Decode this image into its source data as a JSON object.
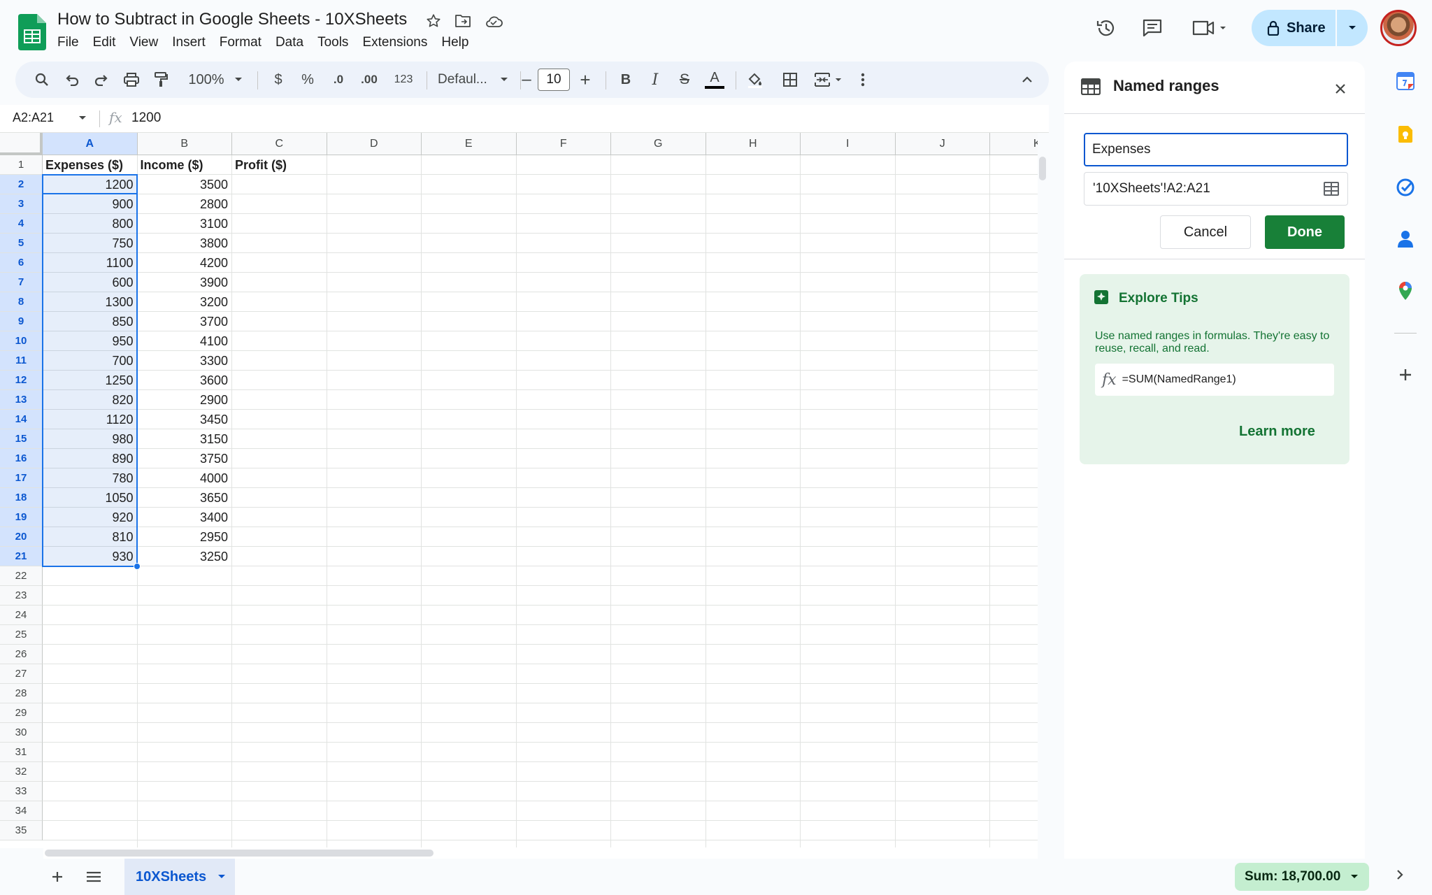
{
  "app": {
    "doc_title": "How to Subtract in Google Sheets - 10XSheets",
    "menu": [
      "File",
      "Edit",
      "View",
      "Insert",
      "Format",
      "Data",
      "Tools",
      "Extensions",
      "Help"
    ],
    "share_label": "Share",
    "brand_color": "#0f9d58",
    "accent_color": "#0b57d0"
  },
  "toolbar": {
    "zoom": "100%",
    "currency": "$",
    "percent": "%",
    "decrease_decimal": ".0",
    "increase_decimal": ".00",
    "number_format": "123",
    "font": "Defaul...",
    "minus": "–",
    "font_size": "10",
    "plus": "+",
    "bold": "B",
    "italic": "I",
    "strike": "S",
    "text_color": "A"
  },
  "formula_bar": {
    "name_box": "A2:A21",
    "fx": "fx",
    "value": "1200"
  },
  "grid": {
    "columns": [
      "A",
      "B",
      "C",
      "D",
      "E",
      "F",
      "G",
      "H",
      "I",
      "J",
      "K"
    ],
    "row_numbers": [
      "1",
      "2",
      "3",
      "4",
      "5",
      "6",
      "7",
      "8",
      "9",
      "10",
      "11",
      "12",
      "13",
      "14",
      "15",
      "16",
      "17",
      "18",
      "19",
      "20",
      "21",
      "22",
      "23",
      "24",
      "25",
      "26",
      "27",
      "28",
      "29",
      "30",
      "31",
      "32",
      "33",
      "34",
      "35"
    ],
    "headers": [
      "Expenses ($)",
      "Income ($)",
      "Profit ($)"
    ],
    "expenses": [
      "1200",
      "900",
      "800",
      "750",
      "1100",
      "600",
      "1300",
      "850",
      "950",
      "700",
      "1250",
      "820",
      "1120",
      "980",
      "890",
      "780",
      "1050",
      "920",
      "810",
      "930"
    ],
    "income": [
      "3500",
      "2800",
      "3100",
      "3800",
      "4200",
      "3900",
      "3200",
      "3700",
      "4100",
      "3300",
      "3600",
      "2900",
      "3450",
      "3150",
      "3750",
      "4000",
      "3650",
      "3400",
      "2950",
      "3250"
    ]
  },
  "sheet_tabs": {
    "active": "10XSheets",
    "sum": "Sum: 18,700.00"
  },
  "named_ranges_panel": {
    "title": "Named ranges",
    "name_value": "Expenses",
    "range_value": "'10XSheets'!A2:A21",
    "cancel_label": "Cancel",
    "done_label": "Done",
    "tips_title": "Explore Tips",
    "tips_body": "Use named ranges in formulas. They're easy to reuse, recall, and read.",
    "tips_fx": "fx",
    "tips_formula": "=SUM(NamedRange1)",
    "learn_more": "Learn more"
  },
  "icons": [
    "sheets-logo-icon",
    "star-icon",
    "move-folder-icon",
    "cloud-saved-icon",
    "history-icon",
    "comment-icon",
    "meet-icon",
    "lock-icon",
    "search-icon",
    "undo-icon",
    "redo-icon",
    "print-icon",
    "paint-format-icon",
    "fill-color-icon",
    "borders-icon",
    "merge-icon",
    "more-vert-icon",
    "collapse-icon",
    "table-icon",
    "close-icon",
    "explore-icon",
    "calendar-icon",
    "keep-icon",
    "tasks-icon",
    "contacts-icon",
    "maps-icon",
    "add-icon"
  ]
}
